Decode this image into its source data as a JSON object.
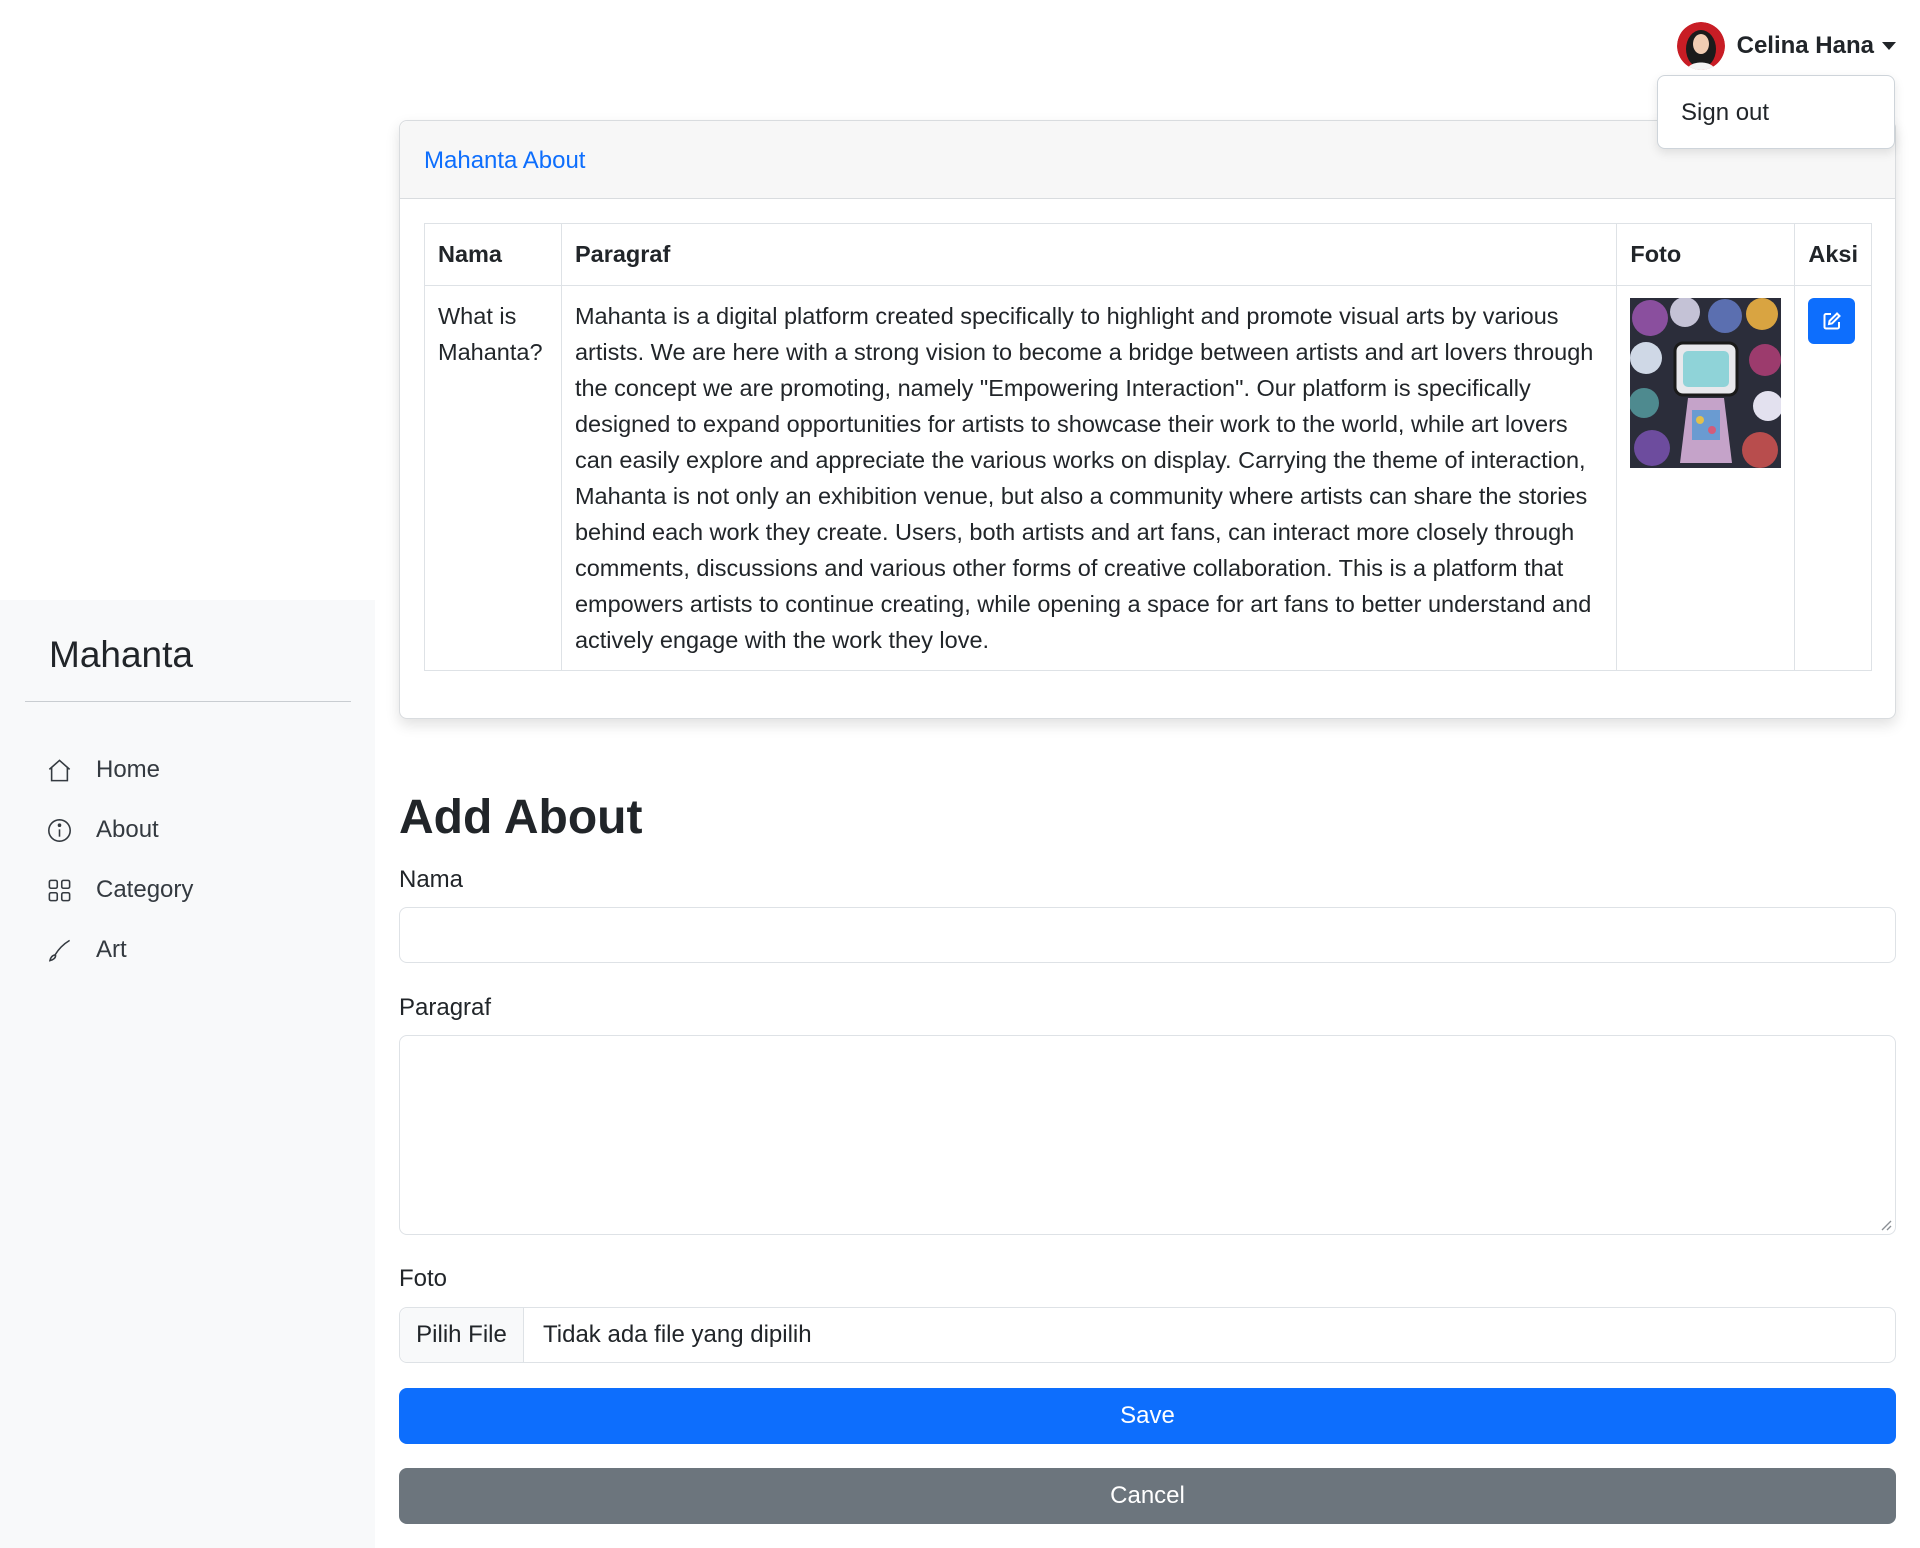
{
  "sidebar": {
    "brand": "Mahanta",
    "items": [
      {
        "label": "Home",
        "icon": "house-icon"
      },
      {
        "label": "About",
        "icon": "info-circle-icon"
      },
      {
        "label": "Category",
        "icon": "grid-icon"
      },
      {
        "label": "Art",
        "icon": "brush-icon"
      }
    ]
  },
  "user": {
    "name": "Celina Hana",
    "menu": {
      "sign_out": "Sign out"
    }
  },
  "card": {
    "title": "Mahanta About",
    "table": {
      "headers": {
        "nama": "Nama",
        "paragraf": "Paragraf",
        "foto": "Foto",
        "aksi": "Aksi"
      },
      "rows": [
        {
          "nama": "What is Mahanta?",
          "paragraf": "Mahanta is a digital platform created specifically to highlight and promote visual arts by various artists. We are here with a strong vision to become a bridge between artists and art lovers through the concept we are promoting, namely \"Empowering Interaction\". Our platform is specifically designed to expand opportunities for artists to showcase their work to the world, while art lovers can easily explore and appreciate the various works on display. Carrying the theme of interaction, Mahanta is not only an exhibition venue, but also a community where artists can share the stories behind each work they create. Users, both artists and art fans, can interact more closely through comments, discussions and various other forms of creative collaboration. This is a platform that empowers artists to continue creating, while opening a space for art fans to better understand and actively engage with the work they love."
        }
      ]
    }
  },
  "form": {
    "title": "Add About",
    "nama_label": "Nama",
    "paragraf_label": "Paragraf",
    "foto_label": "Foto",
    "file_button": "Pilih File",
    "file_status": "Tidak ada file yang dipilih",
    "save": "Save",
    "cancel": "Cancel"
  },
  "colors": {
    "primary": "#0d6efd",
    "secondary": "#6c757d",
    "sidebar_bg": "#f8f9fa"
  }
}
